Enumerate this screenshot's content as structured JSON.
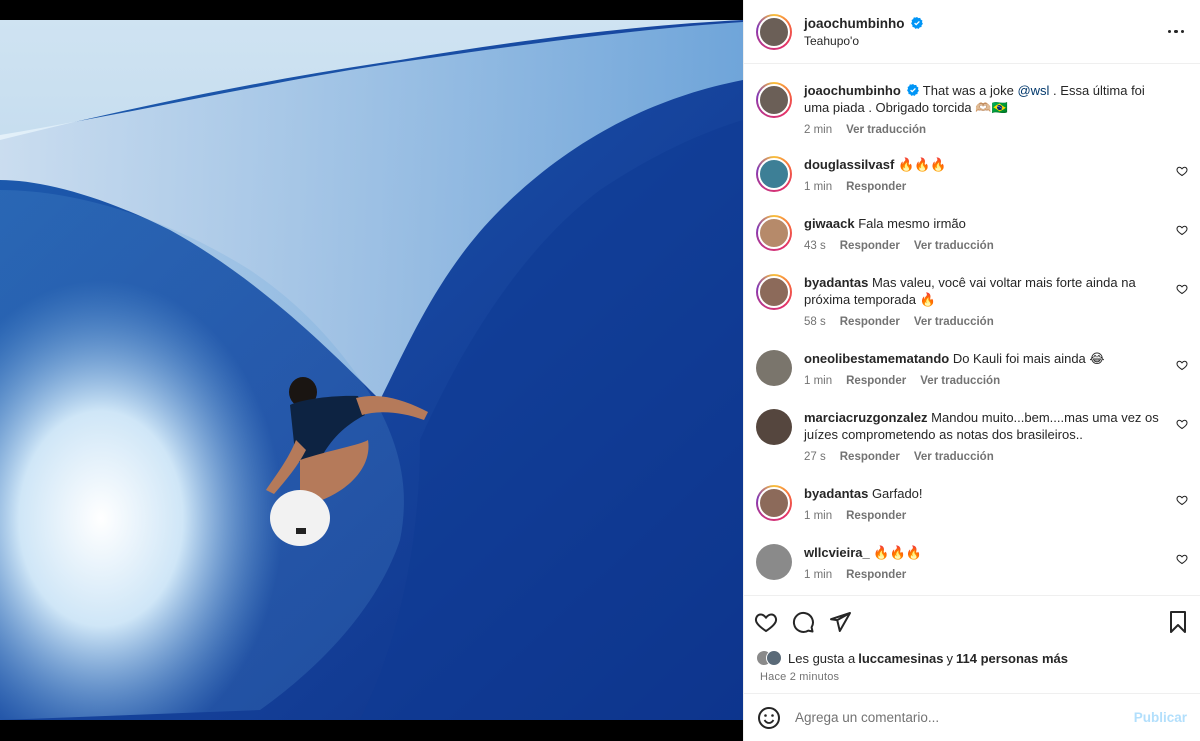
{
  "post": {
    "author": "joaochumbinho",
    "location": "Teahupo'o"
  },
  "caption": {
    "user": "joaochumbinho",
    "text_before": "That was a joke ",
    "mention": "@wsl",
    "text_after": " . Essa última foi uma piada . Obrigado torcida 🫶🏼🇧🇷",
    "time": "2 min",
    "translate": "Ver traducción"
  },
  "comments": [
    {
      "user": "douglassilvasf",
      "text": "🔥🔥🔥",
      "time": "1 min",
      "reply": "Responder",
      "translate": ""
    },
    {
      "user": "giwaack",
      "text": "Fala mesmo irmão",
      "time": "43 s",
      "reply": "Responder",
      "translate": "Ver traducción"
    },
    {
      "user": "byadantas",
      "text": "Mas valeu, você vai voltar mais forte ainda na próxima temporada 🔥",
      "time": "58 s",
      "reply": "Responder",
      "translate": "Ver traducción"
    },
    {
      "user": "oneolibestamematando",
      "text": "Do Kauli foi mais ainda 😂",
      "time": "1 min",
      "reply": "Responder",
      "translate": "Ver traducción"
    },
    {
      "user": "marciacruzgonzalez",
      "text": "Mandou muito...bem....mas uma vez os juízes comprometendo as notas dos brasileiros..",
      "time": "27 s",
      "reply": "Responder",
      "translate": "Ver traducción"
    },
    {
      "user": "byadantas",
      "text": "Garfado!",
      "time": "1 min",
      "reply": "Responder",
      "translate": ""
    },
    {
      "user": "wllcvieira_",
      "text": "🔥🔥🔥",
      "time": "1 min",
      "reply": "Responder",
      "translate": ""
    }
  ],
  "likes": {
    "prefix": "Les gusta a ",
    "user": "luccamesinas",
    "middle": " y ",
    "others": "114 personas más"
  },
  "time_ago": "Hace 2 minutos",
  "composer": {
    "placeholder": "Agrega un comentario...",
    "publish": "Publicar"
  },
  "colors": {
    "verified": "#0095f6",
    "publish_disabled": "#b2dffc",
    "secondary_text": "#737373"
  },
  "icons": {
    "like": "heart-icon",
    "comment": "comment-icon",
    "share": "paper-plane-icon",
    "save": "bookmark-icon",
    "emoji": "smiley-icon",
    "options": "more-options-icon"
  }
}
